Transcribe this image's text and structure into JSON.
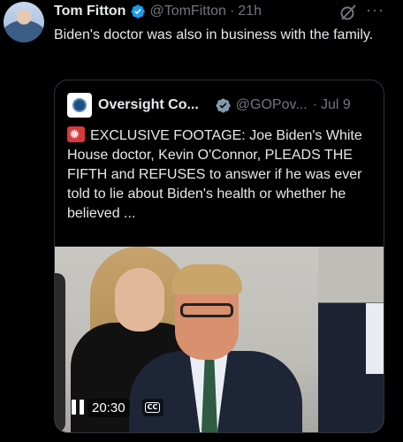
{
  "author": {
    "name": "Tom Fitton",
    "handle": "@TomFitton",
    "separator": "·",
    "time": "21h",
    "avatar_icon": "user-avatar"
  },
  "tweet": {
    "text": "Biden's doctor was also in business with the family."
  },
  "quoted": {
    "name": "Oversight Co...",
    "handle": "@GOPov...",
    "separator": "·",
    "date": "Jul 9",
    "emoji": "rotating-light-icon",
    "text": "EXCLUSIVE FOOTAGE: Joe Biden's White House doctor, Kevin O'Connor, PLEADS THE FIFTH and REFUSES to answer if he was ever told to lie about Biden's health or whether he believed ..."
  },
  "video": {
    "elapsed": "20:30",
    "cc_label": "CC",
    "state": "playing"
  },
  "colors": {
    "background": "#000000",
    "text": "#e7e9ea",
    "muted": "#71767b",
    "verified_blue": "#1d9bf0",
    "verified_gray": "#829aab",
    "border": "#2f3336"
  }
}
